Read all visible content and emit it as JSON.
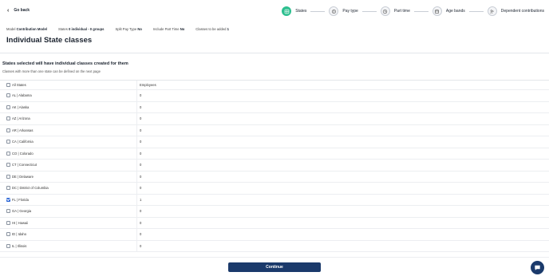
{
  "nav": {
    "back_label": "Go back"
  },
  "steps": [
    {
      "label": "States",
      "active": true
    },
    {
      "label": "Pay type",
      "active": false
    },
    {
      "label": "Part time",
      "active": false
    },
    {
      "label": "Age bands",
      "active": false
    },
    {
      "label": "Dependent contributions",
      "active": false
    }
  ],
  "summary": {
    "model_label": "Model",
    "model_value": "Contribution Model",
    "states_label": "States",
    "states_value": "0 individual - 0 groups",
    "split_label": "Split Pay Type",
    "split_value": "No",
    "parttime_label": "Include Part Time",
    "parttime_value": "No",
    "classes_label": "Classes to be added",
    "classes_value": "1"
  },
  "page": {
    "title": "Individual State classes"
  },
  "section": {
    "heading": "States selected will have individual classes created for them",
    "subtext": "Classes with more than one state can be defined on the next page"
  },
  "table": {
    "all_label": "All States",
    "emp_header": "Employees",
    "rows": [
      {
        "state": "AL | Alabama",
        "employees": "0",
        "checked": false
      },
      {
        "state": "AK | Alaska",
        "employees": "0",
        "checked": false
      },
      {
        "state": "AZ | Arizona",
        "employees": "0",
        "checked": false
      },
      {
        "state": "AR | Arkansas",
        "employees": "0",
        "checked": false
      },
      {
        "state": "CA | California",
        "employees": "0",
        "checked": false
      },
      {
        "state": "CO | Colorado",
        "employees": "0",
        "checked": false
      },
      {
        "state": "CT | Connecticut",
        "employees": "0",
        "checked": false
      },
      {
        "state": "DE | Delaware",
        "employees": "0",
        "checked": false
      },
      {
        "state": "DC | District of Columbia",
        "employees": "0",
        "checked": false
      },
      {
        "state": "FL | Florida",
        "employees": "1",
        "checked": true
      },
      {
        "state": "GA | Georgia",
        "employees": "0",
        "checked": false
      },
      {
        "state": "HI | Hawaii",
        "employees": "0",
        "checked": false
      },
      {
        "state": "ID | Idaho",
        "employees": "0",
        "checked": false
      },
      {
        "state": "IL | Illinois",
        "employees": "0",
        "checked": false
      }
    ]
  },
  "footer": {
    "continue_label": "Continue"
  },
  "colors": {
    "accent": "#2dbf8f",
    "primary": "#1b3a6b",
    "checkbox": "#2c66d6"
  }
}
